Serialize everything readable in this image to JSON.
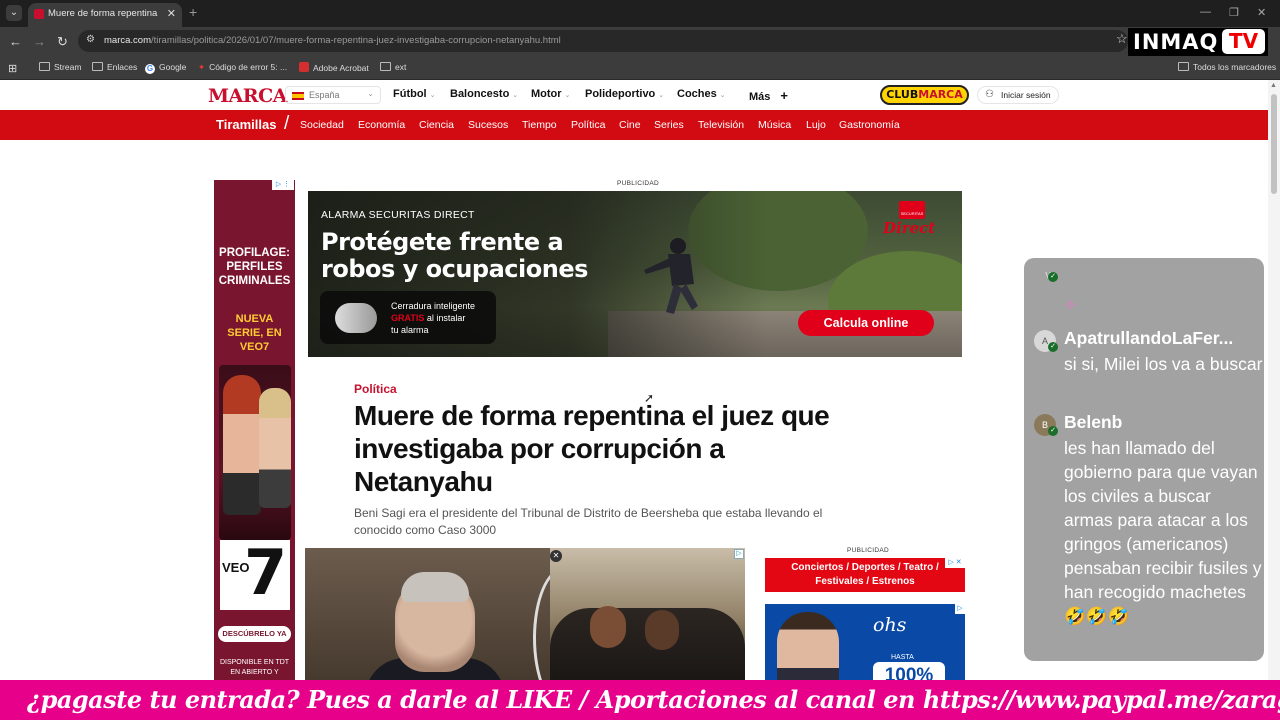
{
  "browser": {
    "tab_title": "Muere de forma repentina el juez",
    "url_domain": "marca.com",
    "url_path": "/tiramillas/politica/2026/01/07/muere-forma-repentina-juez-investigaba-corrupcion-netanyahu.html",
    "bookmarks": [
      "Stream",
      "Enlaces",
      "Google",
      "Código de error 5: ...",
      "Adobe Acrobat",
      "ext"
    ],
    "all_bookmarks": "Todos los marcadores"
  },
  "overlay_logo": {
    "brand": "INMAQ",
    "tv": "TV"
  },
  "marca": {
    "logo": "MARCA",
    "country": "España",
    "nav": [
      "Fútbol",
      "Baloncesto",
      "Motor",
      "Polideportivo",
      "Coches",
      "Más"
    ],
    "more_symbol": "+",
    "club": {
      "pre": "CLUB",
      "main": "MARCA"
    },
    "login": "Iniciar sesión"
  },
  "subnav": {
    "section": "Tiramillas",
    "items": [
      "Sociedad",
      "Economía",
      "Ciencia",
      "Sucesos",
      "Tiempo",
      "Política",
      "Cine",
      "Series",
      "Televisión",
      "Música",
      "Lujo",
      "Gastronomía"
    ]
  },
  "left_ad": {
    "title": "PROFILAGE: PERFILES CRIMINALES",
    "subtitle": "NUEVA SERIE, EN VEO7",
    "logo": "VEO",
    "logo_num": "7",
    "cta": "DESCÚBRELO YA",
    "footer": "DISPONIBLE EN TDT EN ABIERTO Y"
  },
  "banner": {
    "label": "PUBLICIDAD",
    "brand": "ALARMA SECURITAS DIRECT",
    "headline": "Protégete frente a robos y ocupaciones",
    "lock_line1": "Cerradura inteligente",
    "lock_free": "GRATIS",
    "lock_line2": "al instalar",
    "lock_line3": "tu alarma",
    "cta": "Calcula online",
    "logo_small": "SECURITAS",
    "logo_direct": "Direct"
  },
  "article": {
    "kicker": "Política",
    "headline": "Muere de forma repentina el juez que investigaba por corrupción a Netanyahu",
    "standfirst": "Beni Sagi era el presidente del Tribunal de Distrito de Beersheba que estaba llevando el conocido como Caso 3000"
  },
  "right_ads": {
    "label": "PUBLICIDAD",
    "events": "Conciertos / Deportes / Teatro / Festivales / Estrenos",
    "brand": "ohs",
    "hasta": "HASTA",
    "percent": "100%"
  },
  "chat": {
    "messages": [
      {
        "name": "ApatrullandoLaFer...",
        "initials": "A",
        "text": "si si, Milei los va a buscar"
      },
      {
        "name": "Belenb",
        "initials": "B",
        "text": "les han llamado del gobierno para que vayan los civiles a buscar armas para atacar a los gringos (americanos) pensaban recibir fusiles y han recogido machetes 🤣🤣🤣"
      }
    ]
  },
  "ticker": "¿pagaste tu entrada? Pues a darle al LIKE / Aportaciones al canal en https://www.paypal.me/zaragozaviva Bizum"
}
